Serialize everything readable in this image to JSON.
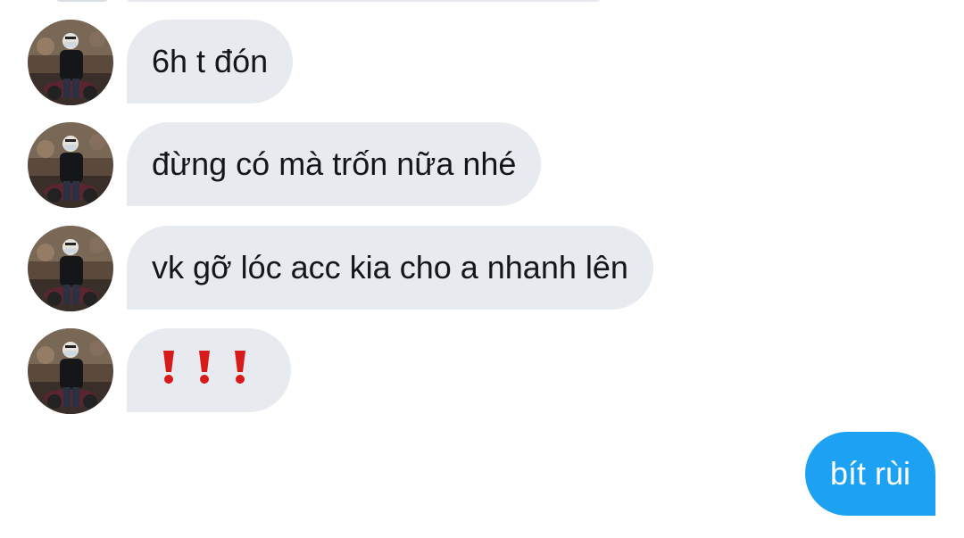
{
  "conversation": {
    "incoming": [
      {
        "text": "6h t đón"
      },
      {
        "text": "đừng có mà trốn nữa nhé"
      },
      {
        "text": "vk gỡ lóc acc kia cho a nhanh lên"
      },
      {
        "text": "",
        "emoji_icons": [
          "exclamation-icon",
          "exclamation-icon",
          "exclamation-icon"
        ]
      }
    ],
    "outgoing": [
      {
        "text": "bít rùi"
      }
    ]
  },
  "colors": {
    "incoming_bubble": "#e7ebef",
    "incoming_text": "#14171a",
    "outgoing_bubble": "#1da1f2",
    "outgoing_text": "#ffffff",
    "emoji_red": "#d71a1a"
  },
  "icons": {
    "avatar": "avatar-photo-icon",
    "emoji": "exclamation-icon"
  }
}
